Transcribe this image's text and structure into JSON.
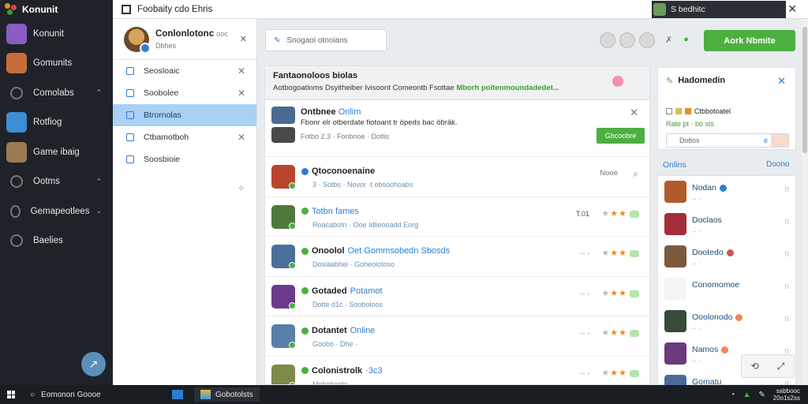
{
  "window": {
    "title": "Foobaity cdo Ehris",
    "user": "S bedhitc",
    "close": "✕"
  },
  "rail": {
    "brand": "Konunit",
    "items": [
      {
        "label": "Konunit",
        "color": "#8a5cc4",
        "chevron": ""
      },
      {
        "label": "Gomunits",
        "color": "#c66d3b",
        "chevron": ""
      },
      {
        "label": "Comolabs",
        "color": "",
        "chevron": "⌃"
      },
      {
        "label": "Rotfiog",
        "color": "#3b8ed4",
        "chevron": ""
      },
      {
        "label": "Game ibaig",
        "color": "#9a7a52",
        "chevron": ""
      },
      {
        "label": "Ootms",
        "color": "",
        "chevron": "⌃"
      },
      {
        "label": "Gemapeotlees",
        "color": "",
        "chevron": "⌄"
      },
      {
        "label": "Baelies",
        "color": "",
        "chevron": ""
      }
    ],
    "fab": "↗"
  },
  "profile": {
    "name": "Conlonlotonc",
    "handle": "ooc",
    "sub": "Dbhes"
  },
  "col2": {
    "items": [
      {
        "label": "Seosloaic",
        "active": false,
        "close": "✕"
      },
      {
        "label": "Soobolee",
        "active": false,
        "close": "✕"
      },
      {
        "label": "Btrornolas",
        "active": true,
        "close": ""
      },
      {
        "label": "Ctbamotboh",
        "active": false,
        "close": "✕"
      },
      {
        "label": "Soosbioie",
        "active": false,
        "close": ""
      }
    ]
  },
  "search": {
    "placeholder": "Snogaoi otnoians"
  },
  "actions": {
    "primary": "Aork Nbmite"
  },
  "banner": {
    "title": "Fantaonoloos biolas",
    "body": "Aotbogoatinms Dsyitheiber Ivisoont Comeontb Fsottae",
    "highlight": "Mborh poltenmoundadedet..."
  },
  "post": {
    "title": "Ontbnee",
    "status": "Onlim",
    "text": "Fbonr elr otberdate fiotoant tr öpeds bac öbräk.",
    "meta": "Fotbo 2.3 · Fonbnoe · Dotlis",
    "button": "Gbcoobre"
  },
  "rows": [
    {
      "title": "Qtoconoenaine",
      "accent": "",
      "line2": "3 ·   Sotbs · Novor ·t obsoohoabs",
      "meta": "",
      "extra": "Nooe",
      "thumb": "#b9452e",
      "stars": false
    },
    {
      "title": "",
      "accent": "Totbn fames",
      "line2": "Roacabotn · Ooe Idlieooadd Eorg",
      "meta": "T.01",
      "extra": "",
      "thumb": "#4d7a3a",
      "stars": true
    },
    {
      "title": "Onoolol",
      "accent": "Oet Gommsobedn Sbosds",
      "line2": "Doslaabhei · Goheolotoso",
      "meta": "·· ·",
      "extra": "",
      "thumb": "#4a6f9c",
      "stars": true
    },
    {
      "title": "Gotaded",
      "accent": "Potamot",
      "line2": "Dotte d1c · Sooboloos",
      "meta": "·· ·",
      "extra": "",
      "thumb": "#6b3a8c",
      "stars": true
    },
    {
      "title": "Dotantet",
      "accent": "Online",
      "line2": "Goobo · Dhe ·",
      "meta": "·· ·",
      "extra": "",
      "thumb": "#5a7fa8",
      "stars": true
    },
    {
      "title": "Colonistrolk",
      "accent": "·3c3",
      "line2": "Moboboide ·",
      "meta": "·· ·",
      "extra": "",
      "thumb": "#7c8a4a",
      "stars": true
    }
  ],
  "notice": {
    "title": "Hadomedin",
    "line1": "Ctbbotoatel",
    "line2": "Rate pt · bo sts",
    "input": "Dotlos",
    "e": "e"
  },
  "online": {
    "title": "Onlins",
    "action": "Doono",
    "items": [
      {
        "name": "Nodan",
        "sub": "·· ·",
        "thumb": "#b15a2c",
        "dot": "#2b7fd0"
      },
      {
        "name": "Doclaos",
        "sub": "·· ·",
        "thumb": "#a32e3a",
        "dot": ""
      },
      {
        "name": "Dootedo",
        "sub": "·· ·",
        "thumb": "#7a5a3a",
        "dot": "#c55"
      },
      {
        "name": "Conomomoe",
        "sub": "",
        "thumb": "#f4f4f4",
        "dot": ""
      },
      {
        "name": "Ooolonodo",
        "sub": "·· ·",
        "thumb": "#3a4a3a",
        "dot": "#e85"
      },
      {
        "name": "Namos",
        "sub": "·· ·",
        "thumb": "#6a3a7c",
        "dot": "#e85"
      },
      {
        "name": "Gomatu",
        "sub": "·· ·",
        "thumb": "#4a6a9a",
        "dot": ""
      }
    ]
  },
  "taskbar": {
    "search": "Eomonon Goooe",
    "app": "Gobotolsts",
    "clock1": "sabbooc",
    "clock2": "20o1s2ss"
  },
  "colors": {
    "accent": "#2b7fd0",
    "green": "#4caf3f",
    "rail": "#1f2329"
  }
}
